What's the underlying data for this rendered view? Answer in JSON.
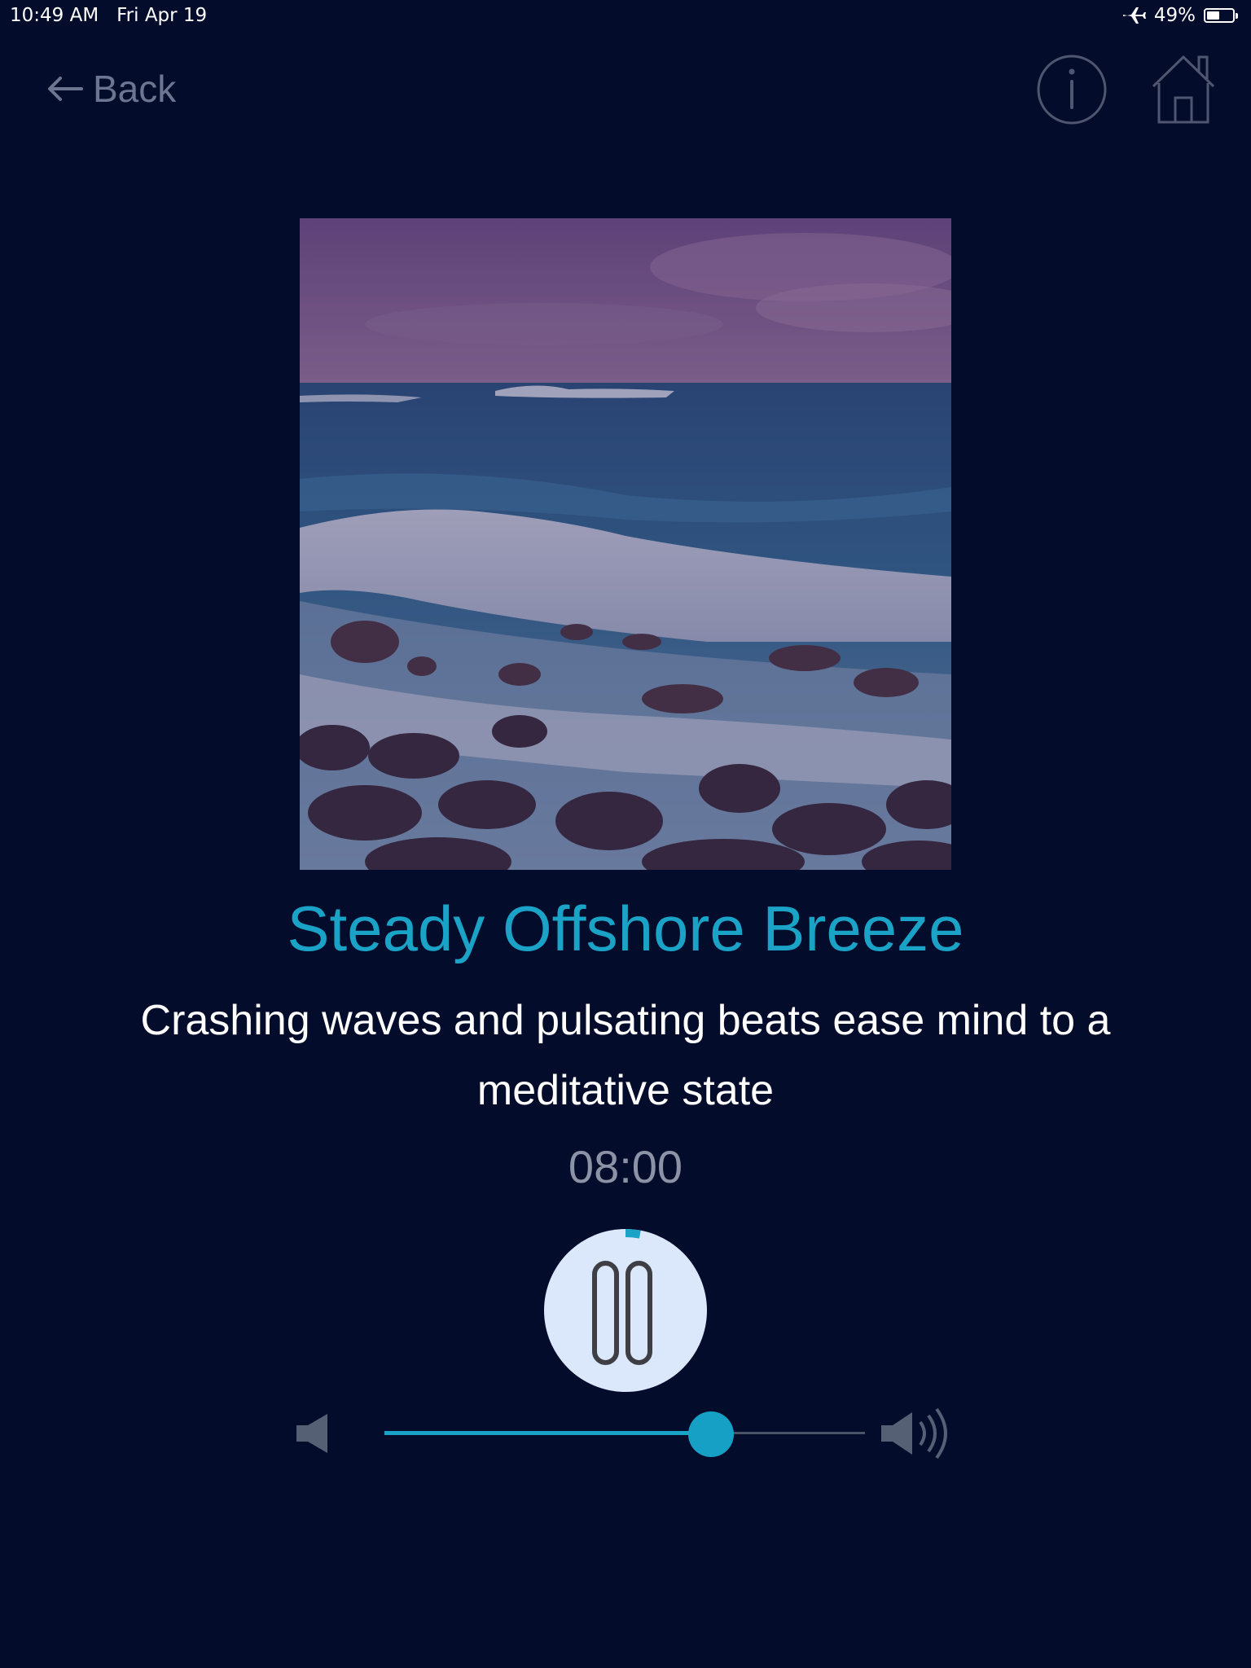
{
  "status_bar": {
    "time": "10:49 AM",
    "date": "Fri Apr 19",
    "battery": "49%",
    "battery_level": 0.49
  },
  "nav": {
    "back_label": "Back"
  },
  "track": {
    "title": "Steady Offshore Breeze",
    "description": "Crashing waves and pulsating beats ease mind to a meditative state",
    "time_remaining": "08:00",
    "state": "playing",
    "playback_progress": 0.03
  },
  "volume": {
    "level": 0.68
  },
  "colors": {
    "background": "#040c2b",
    "accent": "#1aa2c7",
    "muted_text": "#8d93a6",
    "icon_grey": "#6d7690",
    "pause_button_bg": "#dbe7fb"
  },
  "icons": {
    "back": "back-arrow-icon",
    "info": "info-icon",
    "home": "home-icon",
    "pause": "pause-icon",
    "volume_low": "volume-low-icon",
    "volume_high": "volume-high-icon",
    "airplane": "airplane-icon",
    "battery": "battery-icon"
  }
}
